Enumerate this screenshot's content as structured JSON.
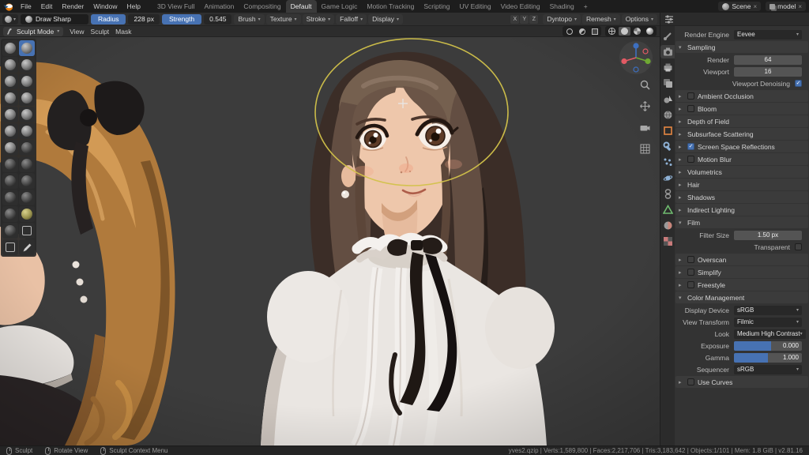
{
  "topbar": {
    "app_menus": [
      "File",
      "Edit",
      "Render",
      "Window",
      "Help"
    ],
    "workspaces": [
      "3D View Full",
      "Animation",
      "Compositing",
      "Default",
      "Game Logic",
      "Motion Tracking",
      "Scripting",
      "UV Editing",
      "Video Editing",
      "Shading"
    ],
    "active_workspace": "Default",
    "add_workspace_label": "+",
    "scene_name": "Scene",
    "view_layer_name": "model",
    "close_glyph": "×"
  },
  "tool_header": {
    "brush_name": "Draw Sharp",
    "radius_label": "Radius",
    "radius_value": "228 px",
    "strength_label": "Strength",
    "strength_value": "0.545",
    "panel_menus": [
      "Brush",
      "Texture",
      "Stroke",
      "Falloff",
      "Display"
    ],
    "mirror_axes": [
      "X",
      "Y",
      "Z"
    ],
    "right_menus": [
      "Dyntopo",
      "Remesh",
      "Options"
    ]
  },
  "viewport": {
    "mode_selector": "Sculpt Mode",
    "menus": [
      "View",
      "Sculpt",
      "Mask"
    ],
    "header_icons": [
      "show-gizmo-icon",
      "show-overlays-icon",
      "toggle-xray-icon",
      "shading-wireframe-icon",
      "shading-solid-icon",
      "shading-material-icon",
      "shading-rendered-icon"
    ],
    "active_shading": "shading-solid-icon",
    "nav_icons": [
      "zoom-icon",
      "pan-icon",
      "camera-view-icon",
      "ortho-grid-icon"
    ],
    "brush_cursor_color": "#d2c24a"
  },
  "toolbar": {
    "active_brush": "Draw Sharp",
    "brushes": [
      {
        "name": "Draw",
        "icon": "sphere"
      },
      {
        "name": "Draw Sharp",
        "icon": "sphere"
      },
      {
        "name": "Clay",
        "icon": "sphere"
      },
      {
        "name": "Clay Strips",
        "icon": "sphere"
      },
      {
        "name": "Layer",
        "icon": "sphere"
      },
      {
        "name": "Inflate",
        "icon": "sphere"
      },
      {
        "name": "Blob",
        "icon": "sphere"
      },
      {
        "name": "Crease",
        "icon": "sphere"
      },
      {
        "name": "Smooth",
        "icon": "sphere"
      },
      {
        "name": "Flatten",
        "icon": "sphere"
      },
      {
        "name": "Fill",
        "icon": "sphere"
      },
      {
        "name": "Scrape",
        "icon": "sphere"
      },
      {
        "name": "Pinch",
        "icon": "sphere"
      },
      {
        "name": "Grab",
        "icon": "sphere-dark"
      },
      {
        "name": "Elastic Deform",
        "icon": "sphere-dark"
      },
      {
        "name": "Snake Hook",
        "icon": "sphere-dark"
      },
      {
        "name": "Thumb",
        "icon": "sphere-dark"
      },
      {
        "name": "Pose",
        "icon": "sphere-dark"
      },
      {
        "name": "Nudge",
        "icon": "sphere-dark"
      },
      {
        "name": "Rotate",
        "icon": "sphere-dark"
      },
      {
        "name": "Slide Relax",
        "icon": "sphere-dark"
      },
      {
        "name": "Simplify",
        "icon": "sphere-olive"
      },
      {
        "name": "Mask",
        "icon": "sphere-dark"
      },
      {
        "name": "Box Mask",
        "icon": "square"
      },
      {
        "name": "Box Hide",
        "icon": "square"
      },
      {
        "name": "Annotate",
        "icon": "pen"
      }
    ]
  },
  "properties": {
    "tabs": [
      "tool",
      "render",
      "output",
      "view-layer",
      "scene",
      "world",
      "object",
      "modifiers",
      "particles",
      "physics",
      "constraints",
      "data",
      "material",
      "texture"
    ],
    "active_tab": "render",
    "panel": [
      {
        "type": "row",
        "label": "Render Engine",
        "widget": "dropdown",
        "value": "Eevee"
      },
      {
        "type": "section",
        "label": "Sampling",
        "expanded": true
      },
      {
        "type": "row",
        "label": "Render",
        "widget": "field",
        "value": "64"
      },
      {
        "type": "row",
        "label": "Viewport",
        "widget": "field",
        "value": "16"
      },
      {
        "type": "row",
        "label": "Viewport Denoising",
        "widget": "check",
        "checked": true
      },
      {
        "type": "section",
        "label": "Ambient Occlusion",
        "check": false
      },
      {
        "type": "section",
        "label": "Bloom",
        "check": false
      },
      {
        "type": "section",
        "label": "Depth of Field"
      },
      {
        "type": "section",
        "label": "Subsurface Scattering"
      },
      {
        "type": "section",
        "label": "Screen Space Reflections",
        "check": true
      },
      {
        "type": "section",
        "label": "Motion Blur",
        "check": false
      },
      {
        "type": "section",
        "label": "Volumetrics"
      },
      {
        "type": "section",
        "label": "Hair"
      },
      {
        "type": "section",
        "label": "Shadows"
      },
      {
        "type": "section",
        "label": "Indirect Lighting"
      },
      {
        "type": "section",
        "label": "Film",
        "expanded": true
      },
      {
        "type": "row",
        "label": "Filter Size",
        "widget": "field",
        "value": "1.50 px"
      },
      {
        "type": "row",
        "label": "Transparent",
        "widget": "check",
        "checked": false
      },
      {
        "type": "section",
        "label": "Overscan",
        "check": false
      },
      {
        "type": "section",
        "label": "Simplify",
        "check": false
      },
      {
        "type": "section",
        "label": "Freestyle",
        "check": false
      },
      {
        "type": "section",
        "label": "Color Management",
        "expanded": true
      },
      {
        "type": "row",
        "label": "Display Device",
        "widget": "dropdown",
        "value": "sRGB"
      },
      {
        "type": "row",
        "label": "View Transform",
        "widget": "dropdown",
        "value": "Filmic"
      },
      {
        "type": "row",
        "label": "Look",
        "widget": "dropdown",
        "value": "Medium High Contrast"
      },
      {
        "type": "row",
        "label": "Exposure",
        "widget": "slider",
        "value": "0.000",
        "fill": 55
      },
      {
        "type": "row",
        "label": "Gamma",
        "widget": "slider",
        "value": "1.000",
        "fill": 50
      },
      {
        "type": "row",
        "label": "Sequencer",
        "widget": "dropdown",
        "value": "sRGB"
      },
      {
        "type": "section",
        "label": "Use Curves",
        "check": false
      }
    ]
  },
  "statusbar": {
    "hints": [
      "Sculpt",
      "Rotate View",
      "Sculpt Context Menu"
    ],
    "stats": "yves2.qzip | Verts:1,589,800 | Faces:2,217,706 | Tris:3,183,642 | Objects:1/101 | Mem: 1.8 GiB | v2.81.16"
  },
  "colors": {
    "accent": "#4772b3",
    "viewport_bg": "#3c3c3c"
  }
}
